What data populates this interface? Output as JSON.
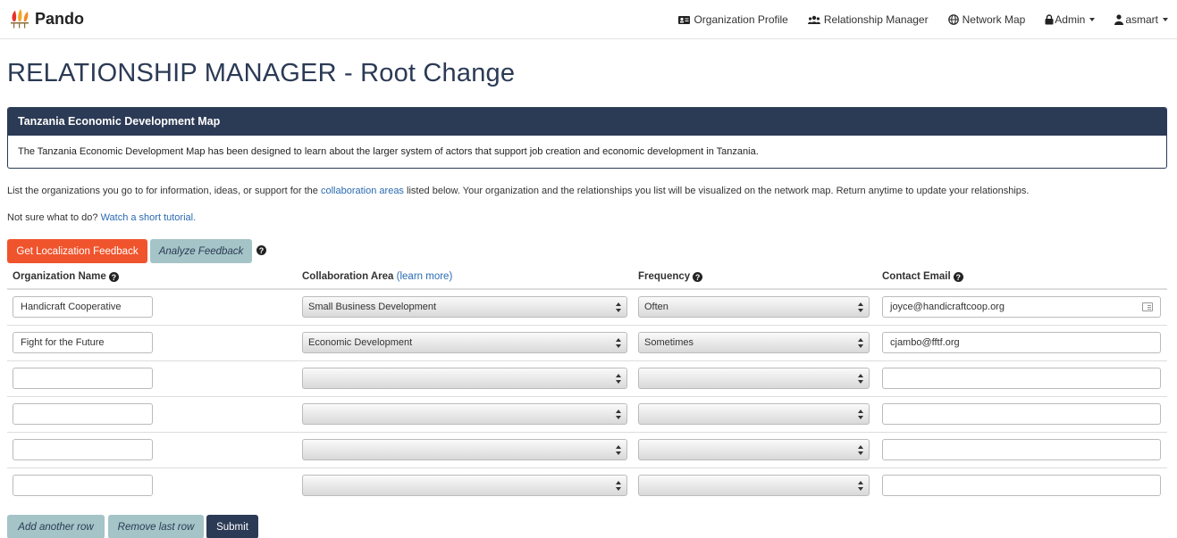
{
  "nav": {
    "brand": "Pando",
    "items": [
      {
        "label": "Organization Profile",
        "icon": "id-card-icon"
      },
      {
        "label": "Relationship Manager",
        "icon": "users-icon"
      },
      {
        "label": "Network Map",
        "icon": "globe-icon"
      },
      {
        "label": "Admin",
        "icon": "lock-icon"
      },
      {
        "label": "asmart",
        "icon": "user-icon"
      }
    ]
  },
  "page_title": "RELATIONSHIP MANAGER - Root Change",
  "panel": {
    "heading": "Tanzania Economic Development Map",
    "body": "The Tanzania Economic Development Map has been designed to learn about the larger system of actors that support job creation and economic development in Tanzania."
  },
  "intro": {
    "before": "List the organizations you go to for information, ideas, or support for the ",
    "link": "collaboration areas",
    "after": " listed below. Your organization and the relationships you list will be visualized on the network map. Return anytime to update your relationships."
  },
  "tutorial": {
    "prefix": "Not sure what to do? ",
    "link": "Watch a short tutorial."
  },
  "buttons": {
    "localization": "Get Localization Feedback",
    "analyze": "Analyze Feedback",
    "add_row": "Add another row",
    "remove_row": "Remove last row",
    "submit": "Submit"
  },
  "columns": {
    "org": "Organization Name",
    "area": "Collaboration Area",
    "area_link": "(learn more)",
    "frequency": "Frequency",
    "email": "Contact Email"
  },
  "rows": [
    {
      "org": "Handicraft Cooperative",
      "area": "Small Business Development",
      "frequency": "Often",
      "email": "joyce@handicraftcoop.org"
    },
    {
      "org": "Fight for the Future",
      "area": "Economic Development",
      "frequency": "Sometimes",
      "email": "cjambo@fftf.org"
    },
    {
      "org": "",
      "area": "",
      "frequency": "",
      "email": ""
    },
    {
      "org": "",
      "area": "",
      "frequency": "",
      "email": ""
    },
    {
      "org": "",
      "area": "",
      "frequency": "",
      "email": ""
    },
    {
      "org": "",
      "area": "",
      "frequency": "",
      "email": ""
    }
  ],
  "colors": {
    "navy": "#2b3a55",
    "accent_red": "#f0542d",
    "teal_button": "#a4c4c7",
    "link": "#2a6bb1"
  }
}
